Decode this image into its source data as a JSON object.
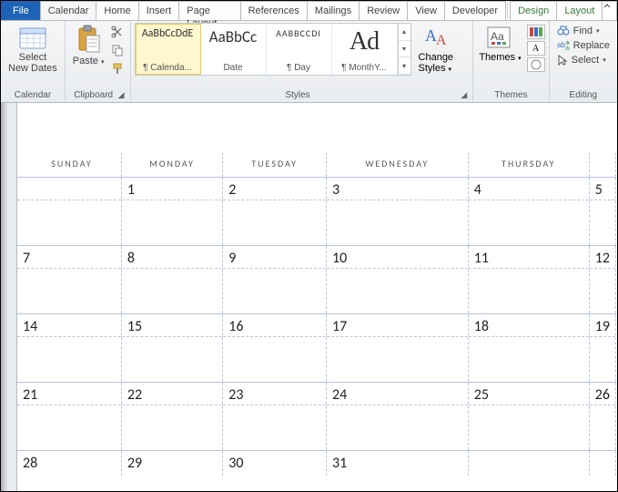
{
  "tabs": {
    "file": "File",
    "items": [
      "Calendar",
      "Home",
      "Insert",
      "Page Layout",
      "References",
      "Mailings",
      "Review",
      "View",
      "Developer"
    ],
    "context": [
      "Design",
      "Layout"
    ],
    "active": "Calendar"
  },
  "ribbon": {
    "calendar": {
      "label": "Calendar",
      "select_new_dates": "Select\nNew Dates"
    },
    "clipboard": {
      "label": "Clipboard",
      "paste": "Paste"
    },
    "styles": {
      "label": "Styles",
      "items": [
        {
          "sample": "AaBbCcDdE",
          "name": "¶ Calenda..."
        },
        {
          "sample": "AaBbCc",
          "name": "Date"
        },
        {
          "sample": "AABBCCDI",
          "name": "¶ Day"
        },
        {
          "sample": "Ad",
          "name": "¶ MonthY..."
        }
      ],
      "change_styles": "Change\nStyles"
    },
    "themes": {
      "label": "Themes",
      "themes": "Themes"
    },
    "editing": {
      "label": "Editing",
      "find": "Find",
      "replace": "Replace",
      "select": "Select"
    }
  },
  "calendar": {
    "headers": [
      "SUNDAY",
      "MONDAY",
      "TUESDAY",
      "WEDNESDAY",
      "THURSDAY",
      ""
    ],
    "rows": [
      [
        "",
        "1",
        "2",
        "3",
        "4",
        "5"
      ],
      [
        "7",
        "8",
        "9",
        "10",
        "11",
        "12"
      ],
      [
        "14",
        "15",
        "16",
        "17",
        "18",
        "19"
      ],
      [
        "21",
        "22",
        "23",
        "24",
        "25",
        "26"
      ],
      [
        "28",
        "29",
        "30",
        "31",
        "",
        ""
      ]
    ]
  }
}
